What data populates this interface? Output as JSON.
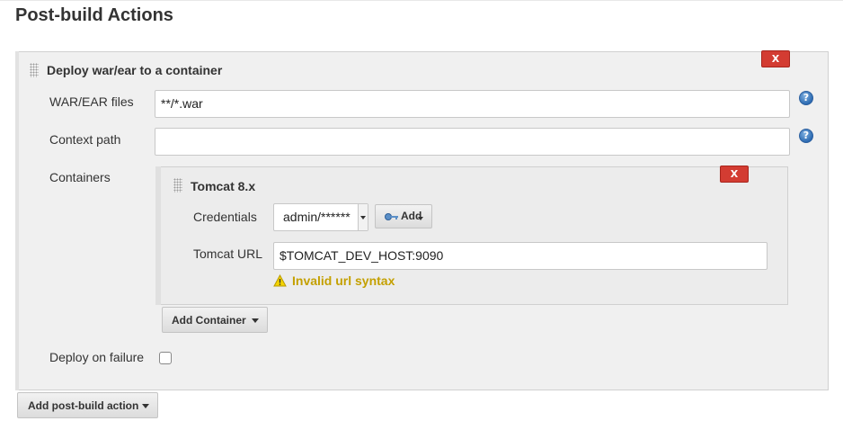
{
  "section": {
    "title": "Post-build Actions"
  },
  "deploy_block": {
    "title": "Deploy war/ear to a container",
    "delete_label": "X",
    "war_ear": {
      "label": "WAR/EAR files",
      "value": "**/*.war"
    },
    "context_path": {
      "label": "Context path",
      "value": ""
    },
    "containers_label": "Containers",
    "tomcat": {
      "title": "Tomcat 8.x",
      "delete_label": "X",
      "credentials": {
        "label": "Credentials",
        "selected": "admin/******",
        "add_label": "Add"
      },
      "url": {
        "label": "Tomcat URL",
        "value": "$TOMCAT_DEV_HOST:9090",
        "warning": "Invalid url syntax"
      }
    },
    "add_container_label": "Add Container",
    "deploy_on_failure": {
      "label": "Deploy on failure",
      "checked": false
    }
  },
  "add_post_build_label": "Add post-build action",
  "icons": {
    "help": "help-icon",
    "warning": "warning-icon",
    "key": "key-icon",
    "grip": "drag-handle-icon"
  }
}
